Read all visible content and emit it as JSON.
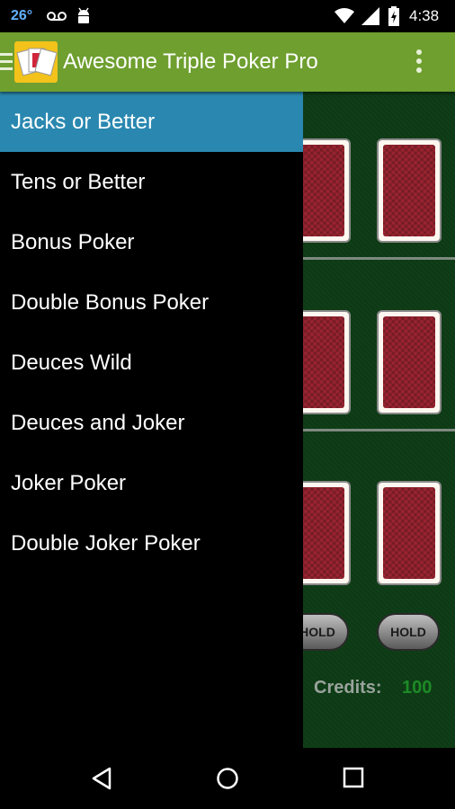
{
  "status_bar": {
    "temperature": "26°",
    "time": "4:38",
    "icons": [
      "voicemail-icon",
      "android-debug-icon",
      "wifi-icon",
      "signal-icon",
      "battery-charging-icon"
    ]
  },
  "action_bar": {
    "title": "Awesome Triple Poker Pro",
    "icons": [
      "drawer-menu-icon",
      "app-cards-icon",
      "overflow-menu-icon"
    ]
  },
  "drawer": {
    "items": [
      {
        "label": "Jacks or Better",
        "selected": true
      },
      {
        "label": "Tens or Better",
        "selected": false
      },
      {
        "label": "Bonus Poker",
        "selected": false
      },
      {
        "label": "Double Bonus Poker",
        "selected": false
      },
      {
        "label": "Deuces Wild",
        "selected": false
      },
      {
        "label": "Deuces and Joker",
        "selected": false
      },
      {
        "label": "Joker Poker",
        "selected": false
      },
      {
        "label": "Double Joker Poker",
        "selected": false
      }
    ],
    "selected_color": "#2a88b0"
  },
  "game": {
    "hold_buttons": [
      "HOLD",
      "HOLD"
    ],
    "credits_label": "Credits:",
    "credits_value": "100",
    "table_color": "#0c3a14",
    "card_back_color": "#9a2430"
  },
  "nav_bar": {
    "icons": [
      "back-icon",
      "home-icon",
      "recents-icon"
    ]
  },
  "colors": {
    "action_bar": "#6e9f2f",
    "credits_value": "#1d8a27"
  }
}
